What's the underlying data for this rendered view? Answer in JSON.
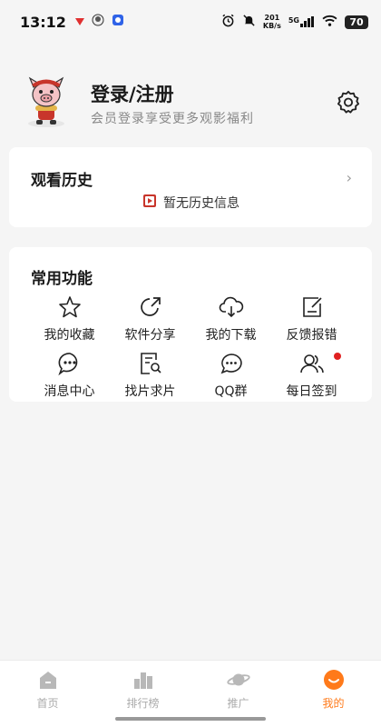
{
  "status_bar": {
    "time": "13:12",
    "net_speed_value": "201",
    "net_speed_unit": "KB/s",
    "network": "5G",
    "battery": "70"
  },
  "profile": {
    "title": "登录/注册",
    "subtitle": "会员登录享受更多观影福利",
    "avatar_icon": "pig-avatar-icon",
    "settings_icon": "gear-icon"
  },
  "history": {
    "title": "观看历史",
    "chevron": "›",
    "empty_text": "暂无历史信息"
  },
  "functions": {
    "title": "常用功能",
    "items": [
      {
        "label": "我的收藏",
        "icon": "star-icon"
      },
      {
        "label": "软件分享",
        "icon": "share-icon"
      },
      {
        "label": "我的下载",
        "icon": "cloud-download-icon"
      },
      {
        "label": "反馈报错",
        "icon": "feedback-icon"
      },
      {
        "label": "消息中心",
        "icon": "message-icon"
      },
      {
        "label": "找片求片",
        "icon": "search-doc-icon"
      },
      {
        "label": "QQ群",
        "icon": "chat-icon"
      },
      {
        "label": "每日签到",
        "icon": "users-icon"
      }
    ]
  },
  "tabbar": {
    "tabs": [
      {
        "label": "首页",
        "icon": "home-icon"
      },
      {
        "label": "排行榜",
        "icon": "bar-chart-icon"
      },
      {
        "label": "推广",
        "icon": "planet-icon"
      },
      {
        "label": "我的",
        "icon": "smile-icon"
      }
    ],
    "active_color": "#ff7a1a",
    "inactive_color": "#aaaaaa"
  }
}
